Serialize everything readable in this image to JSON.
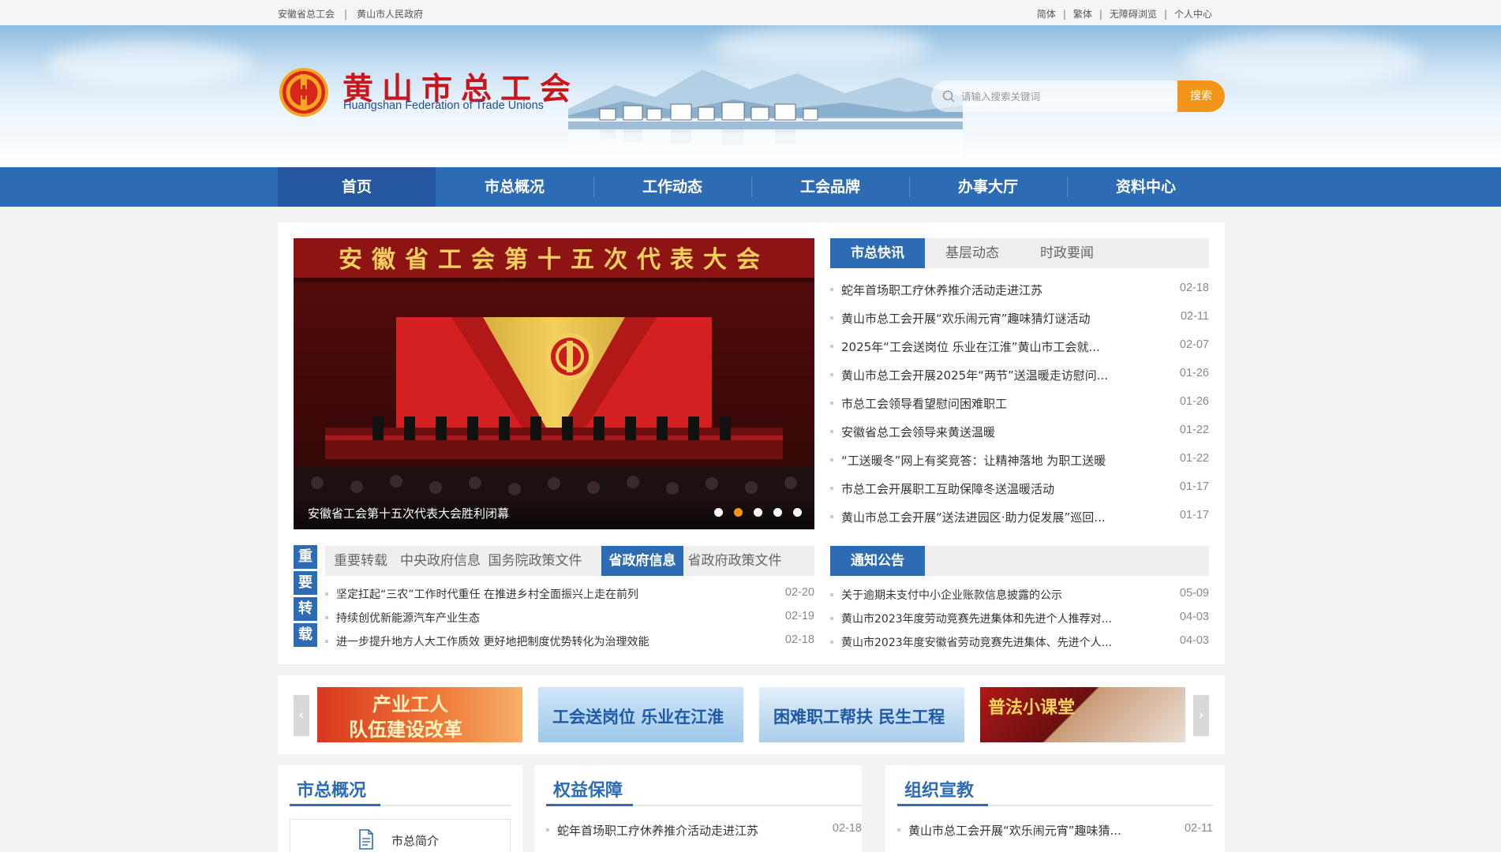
{
  "topbar": {
    "left_links": [
      "安徽省总工会",
      "黄山市人民政府"
    ],
    "right_links": [
      "简体",
      "繁体",
      "无障碍浏览",
      "个人中心"
    ]
  },
  "header": {
    "logo_cn": "黄山市总工会",
    "logo_en": "Huangshan Federation of Trade Unions"
  },
  "search": {
    "placeholder": "请输入搜索关键词",
    "button": "搜索"
  },
  "nav": [
    "首页",
    "市总概况",
    "工作动态",
    "工会品牌",
    "办事大厅",
    "资料中心"
  ],
  "slider": {
    "banner_text": "安徽省工会第十五次代表大会",
    "caption": "安徽省工会第十五次代表大会胜利闭幕",
    "dot_count": 5,
    "active_dot": 1
  },
  "news_tabs": [
    "市总快讯",
    "基层动态",
    "时政要闻"
  ],
  "news": [
    {
      "title": "蛇年首场职工疗休养推介活动走进江苏",
      "date": "02-18"
    },
    {
      "title": "黄山市总工会开展“欢乐闹元宵”趣味猜灯谜活动",
      "date": "02-11"
    },
    {
      "title": "2025年“工会送岗位 乐业在江淮”黄山市工会就...",
      "date": "02-07"
    },
    {
      "title": "黄山市总工会开展2025年“两节”送温暖走访慰问...",
      "date": "01-26"
    },
    {
      "title": "市总工会领导看望慰问困难职工",
      "date": "01-26"
    },
    {
      "title": "安徽省总工会领导来黄送温暖",
      "date": "01-22"
    },
    {
      "title": "“工送暖冬”网上有奖竞答：让精神落地 为职工送暖",
      "date": "01-22"
    },
    {
      "title": "市总工会开展职工互助保障冬送温暖活动",
      "date": "01-17"
    },
    {
      "title": "黄山市总工会开展“送法进园区·助力促发展”巡回...",
      "date": "01-17"
    }
  ],
  "reprint": {
    "side_label": [
      "重",
      "要",
      "转",
      "载"
    ],
    "tabs": [
      "重要转载",
      "中央政府信息",
      "国务院政策文件",
      "省政府信息",
      "省政府政策文件"
    ],
    "items": [
      {
        "title": "坚定扛起“三农”工作时代重任 在推进乡村全面振兴上走在前列",
        "date": "02-20"
      },
      {
        "title": "持续创优新能源汽车产业生态",
        "date": "02-19"
      },
      {
        "title": "进一步提升地方人大工作质效 更好地把制度优势转化为治理效能",
        "date": "02-18"
      }
    ]
  },
  "notice": {
    "tab": "通知公告",
    "items": [
      {
        "title": "关于逾期未支付中小企业账款信息披露的公示",
        "date": "05-09"
      },
      {
        "title": "黄山市2023年度劳动竞赛先进集体和先进个人推荐对...",
        "date": "04-03"
      },
      {
        "title": "黄山市2023年度安徽省劳动竞赛先进集体、先进个人...",
        "date": "04-03"
      }
    ]
  },
  "promos": [
    {
      "line1": "产业工人",
      "line2": "队伍建设改革"
    },
    {
      "line1": "工会送岗位 乐业在江淮"
    },
    {
      "line1": "困难职工帮扶 民生工程"
    },
    {
      "line1": "普法小课堂"
    }
  ],
  "sections": {
    "overview": {
      "title": "市总概况",
      "item": "市总简介"
    },
    "rights": {
      "title": "权益保障",
      "item": {
        "title": "蛇年首场职工疗休养推介活动走进江苏",
        "date": "02-18"
      }
    },
    "org": {
      "title": "组织宣教",
      "item": {
        "title": "黄山市总工会开展“欢乐闹元宵”趣味猜...",
        "date": "02-11"
      }
    }
  },
  "colors": {
    "nav_blue": "#2e6bb5",
    "accent_orange": "#f39518",
    "logo_red": "#c8161d"
  }
}
